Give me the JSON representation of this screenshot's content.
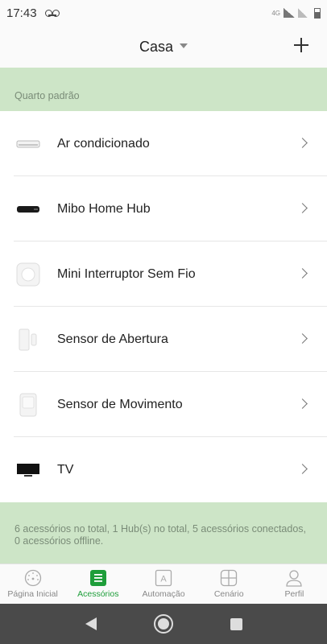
{
  "status_bar": {
    "time": "17:43",
    "network": "4G"
  },
  "header": {
    "title": "Casa"
  },
  "section": {
    "label": "Quarto padrão"
  },
  "accessories": [
    {
      "label": "Ar condicionado",
      "icon": "air-conditioner-icon"
    },
    {
      "label": "Mibo Home Hub",
      "icon": "hub-icon"
    },
    {
      "label": "Mini Interruptor Sem Fio",
      "icon": "wireless-switch-icon"
    },
    {
      "label": "Sensor de Abertura",
      "icon": "door-sensor-icon"
    },
    {
      "label": "Sensor de Movimento",
      "icon": "motion-sensor-icon"
    },
    {
      "label": "TV",
      "icon": "tv-icon"
    }
  ],
  "summary": {
    "text": "6 acessórios no total, 1 Hub(s) no total, 5 acessórios conectados, 0 acessórios offline."
  },
  "tabs": [
    {
      "label": "Página Inicial",
      "icon": "home-dial-icon",
      "active": false
    },
    {
      "label": "Acessórios",
      "icon": "accessories-icon",
      "active": true
    },
    {
      "label": "Automação",
      "icon": "automation-icon",
      "active": false
    },
    {
      "label": "Cenário",
      "icon": "scene-icon",
      "active": false
    },
    {
      "label": "Perfil",
      "icon": "profile-icon",
      "active": false
    }
  ],
  "colors": {
    "accent": "#1e9e3a",
    "band": "#cde5c7"
  }
}
